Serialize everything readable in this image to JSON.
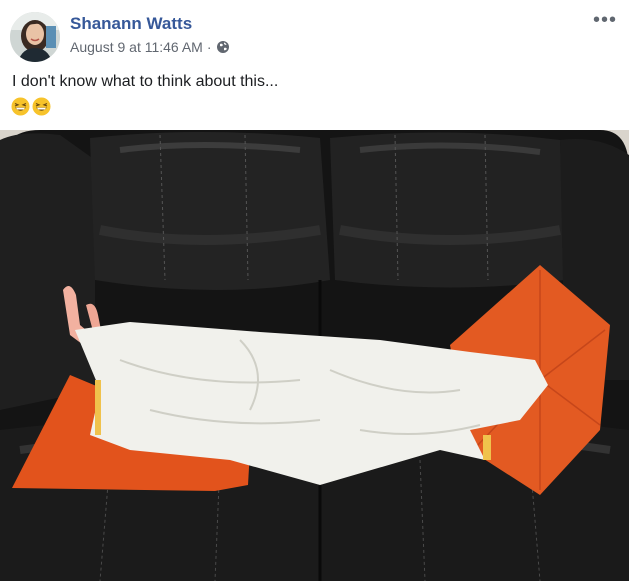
{
  "post": {
    "author": "Shanann Watts",
    "date": "August 9 at 11:46 AM",
    "separator": "·",
    "more_label": "•••",
    "text": "I don't know what to think about this...",
    "emojis": [
      "grinning-squinting-face",
      "grinning-squinting-face"
    ],
    "privacy_icon": "globe-icon"
  },
  "colors": {
    "author_link": "#365899",
    "meta_text": "#616770",
    "couch": "#1a1a1a",
    "pillow": "#e2531c",
    "sheet": "#f1f1ec"
  }
}
